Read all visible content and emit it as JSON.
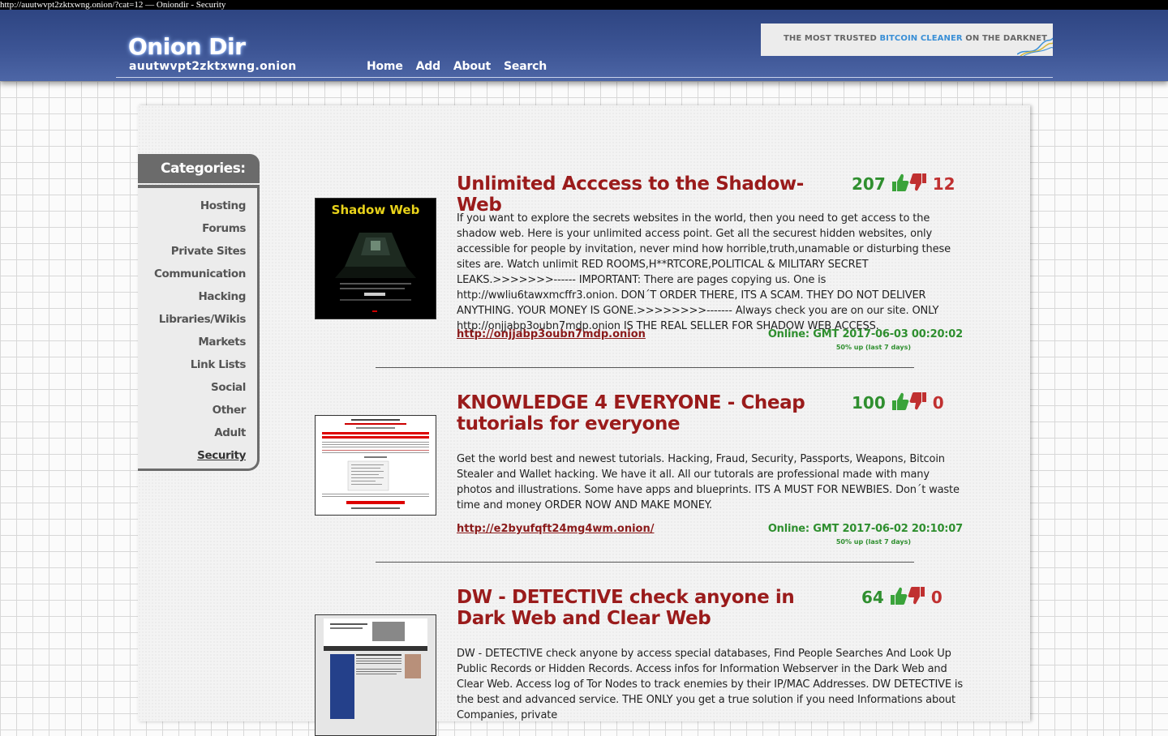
{
  "window": {
    "title": "http://auutwvpt2zktxwng.onion/?cat=12 — Oniondir - Security"
  },
  "header": {
    "logo": "Onion Dir",
    "domain": "auutwvpt2zktxwng.onion",
    "nav": [
      "Home",
      "Add",
      "About",
      "Search"
    ],
    "banner": {
      "prefix": "THE MOST TRUSTED ",
      "highlight": "BITCOIN CLEANER",
      "suffix": " ON THE DARKNET"
    }
  },
  "sidebar": {
    "heading": "Categories:",
    "items": [
      "Hosting",
      "Forums",
      "Private Sites",
      "Communication",
      "Hacking",
      "Libraries/Wikis",
      "Markets",
      "Link Lists",
      "Social",
      "Other",
      "Adult",
      "Security"
    ],
    "active": "Security"
  },
  "listings": [
    {
      "title": "Unlimited Acccess to the Shadow-Web",
      "upvotes": "207",
      "downvotes": "12",
      "description": "If you want to explore the secrets websites in the world, then you need to get access to the shadow web. Here is your unlimited access point. Get all the securest hidden websites, only accessible for people by invitation, never mind how horrible,truth,unamable or disturbing these sites are. Watch unlimit RED ROOMS,H**RTCORE,POLITICAL & MILITARY SECRET LEAKS.>>>>>>>------ IMPORTANT: There are pages copying us. One is http://wwliu6tawxmcffr3.onion. DON´T ORDER THERE, ITS A SCAM. THEY DO NOT DELIVER ANYTHING. YOUR MONEY IS GONE.>>>>>>>>------- Always check you are on our site. ONLY http://onjjabp3oubn7mdp.onion IS THE REAL SELLER FOR SHADOW WEB ACCESS.",
      "url": "http://onjjabp3oubn7mdp.onion",
      "online": "Online: GMT 2017-06-03 00:20:02",
      "uptime": "50% up (last 7 days)",
      "thumb_text": "Shadow Web"
    },
    {
      "title": "KNOWLEDGE 4 EVERYONE - Cheap tutorials for everyone",
      "upvotes": "100",
      "downvotes": "0",
      "description": "Get the world best and newest tutorials. Hacking, Fraud, Security, Passports, Weapons, Bitcoin Stealer and Wallet hacking. We have it all. All our tutorals are professional made with many photos and illustrations. Some have apps and blueprints. ITS A MUST FOR NEWBIES. Don´t waste time and money ORDER NOW AND MAKE MONEY.",
      "url": "http://e2byufqft24mg4wm.onion/",
      "online": "Online: GMT 2017-06-02 20:10:07",
      "uptime": "50% up (last 7 days)"
    },
    {
      "title": "DW - DETECTIVE check anyone in Dark Web and Clear Web",
      "upvotes": "64",
      "downvotes": "0",
      "description": "DW - DETECTIVE check anyone by access special databases, Find People Searches And Look Up Public Records or Hidden Records. Access infos for Information Webserver in the Dark Web and Clear Web. Access log of Tor Nodes to track enemies by their IP/MAC Addresses. DW DETECTIVE is the best and advanced service. THE ONLY you get a true solution if you need Informations about Companies, private"
    }
  ],
  "colors": {
    "header": "#3c5494",
    "title_red": "#9a1b1b",
    "vote_green": "#2f8f2f",
    "vote_red": "#c03030"
  }
}
